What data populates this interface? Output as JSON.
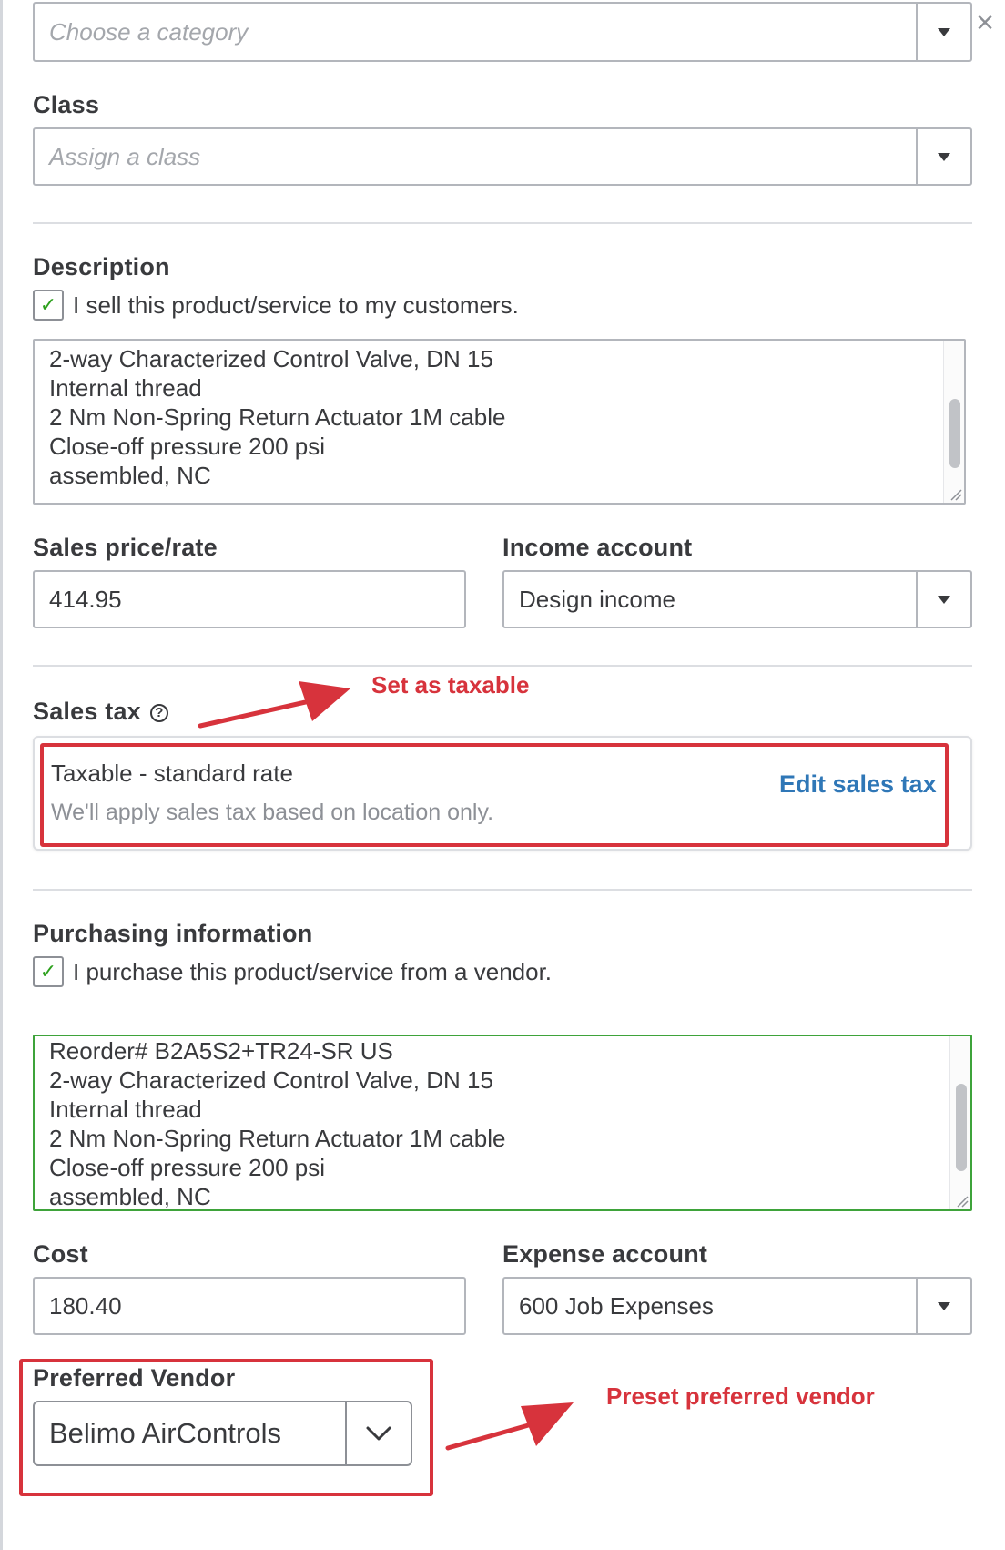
{
  "close_label": "×",
  "category": {
    "placeholder": "Choose a category"
  },
  "class_field": {
    "label": "Class",
    "placeholder": "Assign a class"
  },
  "description": {
    "label": "Description",
    "sell_checkbox_label": "I sell this product/service to my customers.",
    "sell_checked": true,
    "lines": [
      "2-way Characterized Control Valve, DN 15",
      "Internal thread",
      "2 Nm Non-Spring Return Actuator 1M cable",
      "Close-off pressure 200 psi",
      "assembled, NC"
    ]
  },
  "sales_price": {
    "label": "Sales price/rate",
    "value": "414.95"
  },
  "income_account": {
    "label": "Income account",
    "value": "Design income"
  },
  "sales_tax": {
    "label": "Sales tax",
    "title": "Taxable - standard rate",
    "subtitle": "We'll apply sales tax based on location only.",
    "edit_label": "Edit sales tax"
  },
  "purchasing": {
    "label": "Purchasing information",
    "purchase_checkbox_label": "I purchase this product/service from a vendor.",
    "purchase_checked": true,
    "lines": [
      "Reorder# B2A5S2+TR24-SR US",
      "2-way Characterized Control Valve, DN 15",
      "Internal thread",
      "2 Nm Non-Spring Return Actuator 1M cable",
      "Close-off pressure 200 psi",
      "assembled, NC"
    ]
  },
  "cost": {
    "label": "Cost",
    "value": "180.40"
  },
  "expense_account": {
    "label": "Expense account",
    "value": "600 Job Expenses"
  },
  "preferred_vendor": {
    "label": "Preferred Vendor",
    "value": "Belimo AirControls"
  },
  "annotations": {
    "taxable": "Set as taxable",
    "vendor": "Preset preferred vendor",
    "color": "#d7333c"
  },
  "colors": {
    "check": "#2ca01c",
    "link": "#2f77b7",
    "active_border": "#3ea33a"
  }
}
